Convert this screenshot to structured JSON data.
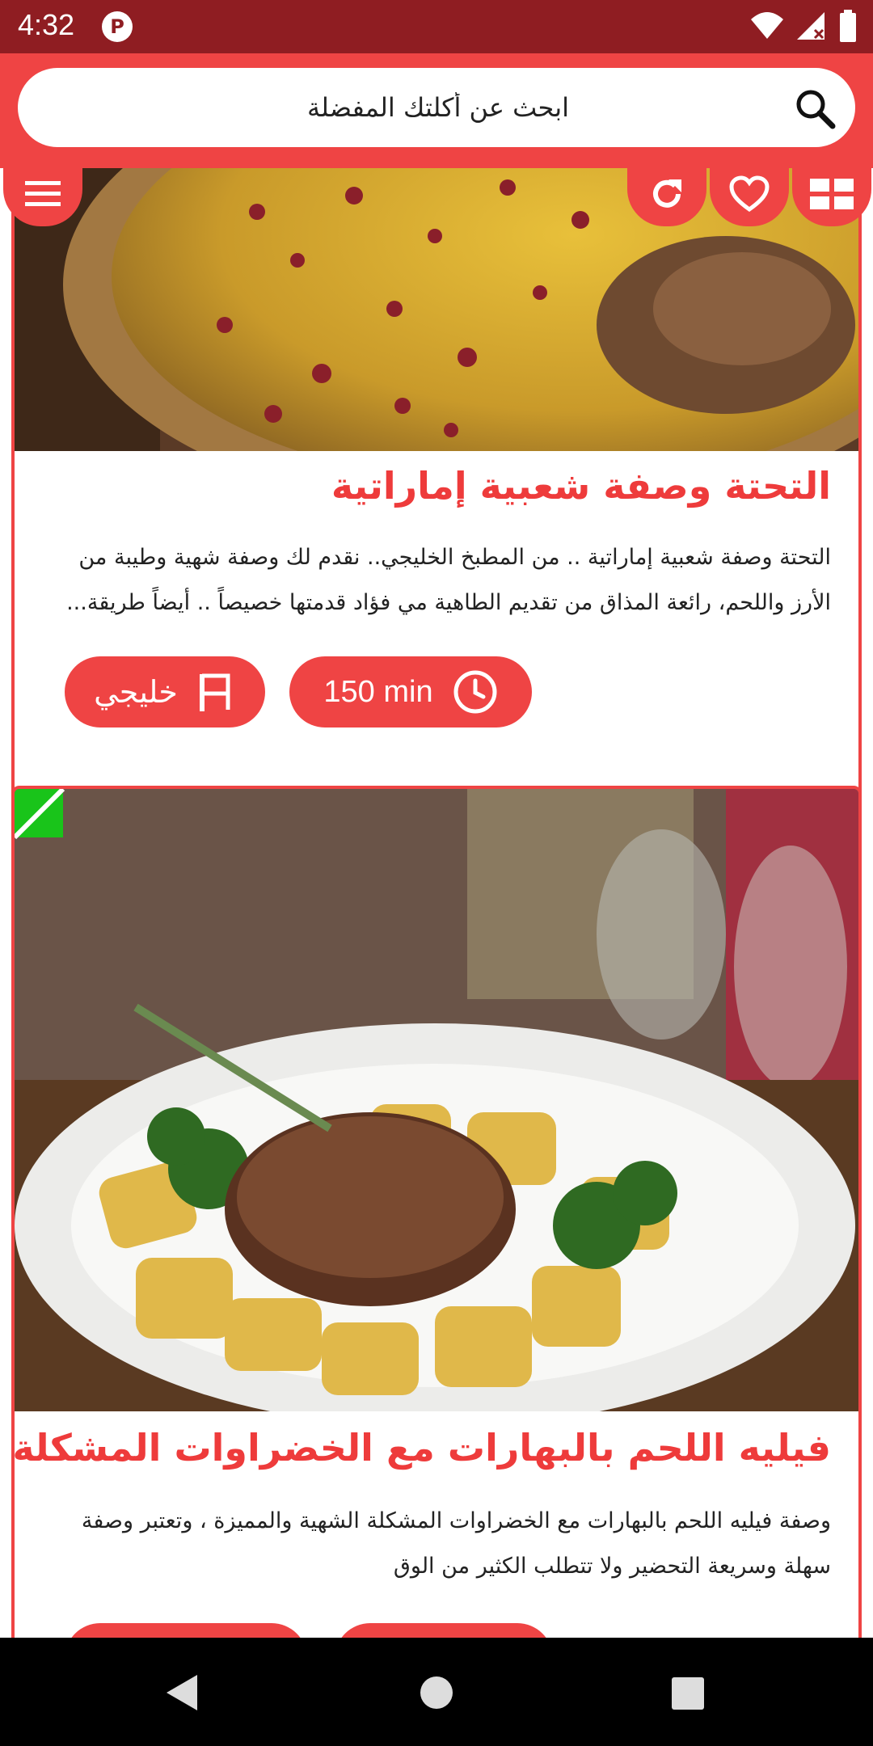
{
  "status_bar": {
    "time": "4:32",
    "app_icon": "app-notification-icon",
    "icons": [
      "wifi-icon",
      "signal-icon",
      "battery-icon"
    ]
  },
  "search": {
    "placeholder": "ابحث عن أكلتك المفضلة",
    "icon": "search-icon"
  },
  "toolbar": {
    "menu_icon": "hamburger-menu-icon",
    "refresh_icon": "refresh-icon",
    "favorite_icon": "heart-icon",
    "grid_icon": "grid-view-icon"
  },
  "recipes": [
    {
      "title": "التحتة وصفة شعبية إماراتية",
      "description": "التحتة وصفة شعبية إماراتية .. من المطبخ الخليجي.. نقدم لك وصفة شهية وطيبة من الأرز واللحم، رائعة المذاق من تقديم الطاهية مي فؤاد قدمتها خصيصاً .. أيضاً طريقة...",
      "time": "150 min",
      "cuisine": "خليجي",
      "image": "rice-with-meat-dish-photo"
    },
    {
      "title": "فيليه اللحم بالبهارات مع الخضراوات المشكلة الش...",
      "description": "وصفة فيليه اللحم بالبهارات مع الخضراوات المشكلة الشهية والمميزة ، وتعتبر وصفة سهلة وسريعة التحضير ولا تتطلب الكثير من الوق",
      "image": "beef-fillet-with-vegetables-photo"
    }
  ],
  "colors": {
    "primary": "#ef4444",
    "status_bar": "#8f1d22",
    "title": "#ee3b3b",
    "nav_bar": "#000000"
  },
  "nav": {
    "back_icon": "back-triangle-icon",
    "home_icon": "home-circle-icon",
    "recents_icon": "recents-square-icon"
  }
}
